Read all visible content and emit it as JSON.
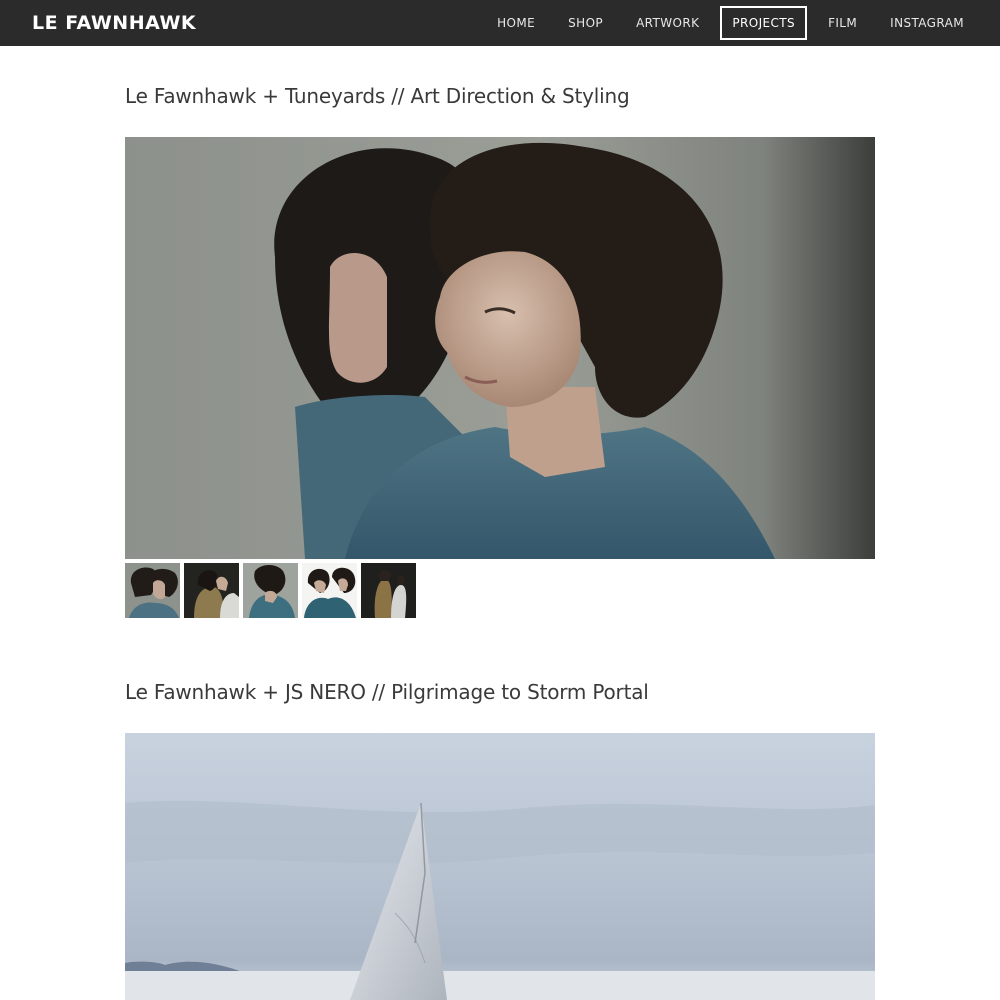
{
  "site": {
    "brand": "LE FAWNHAWK",
    "nav": [
      {
        "label": "HOME"
      },
      {
        "label": "SHOP"
      },
      {
        "label": "ARTWORK"
      },
      {
        "label": "PROJECTS",
        "active": true
      },
      {
        "label": "FILM"
      },
      {
        "label": "INSTAGRAM"
      }
    ]
  },
  "projects": [
    {
      "title": "Le Fawnhawk + Tuneyards // Art Direction & Styling",
      "hero_image": "portrait of two people with curly dark hair in blue-grey shirts against a grey wall",
      "thumbnails": [
        "thumb-two-profiles",
        "thumb-back-to-back",
        "thumb-hair-swing",
        "thumb-pair-portrait",
        "thumb-standing-pair"
      ]
    },
    {
      "title": "Le Fawnhawk + JS NERO // Pilgrimage to Storm Portal",
      "hero_image": "white pyramid-shaped sail sculpture on a pale salt flat under a cloudy sky"
    }
  ],
  "colors": {
    "header_bg": "#2b2b2b",
    "header_text": "#ffffff",
    "title_text": "#3a3a3a"
  }
}
